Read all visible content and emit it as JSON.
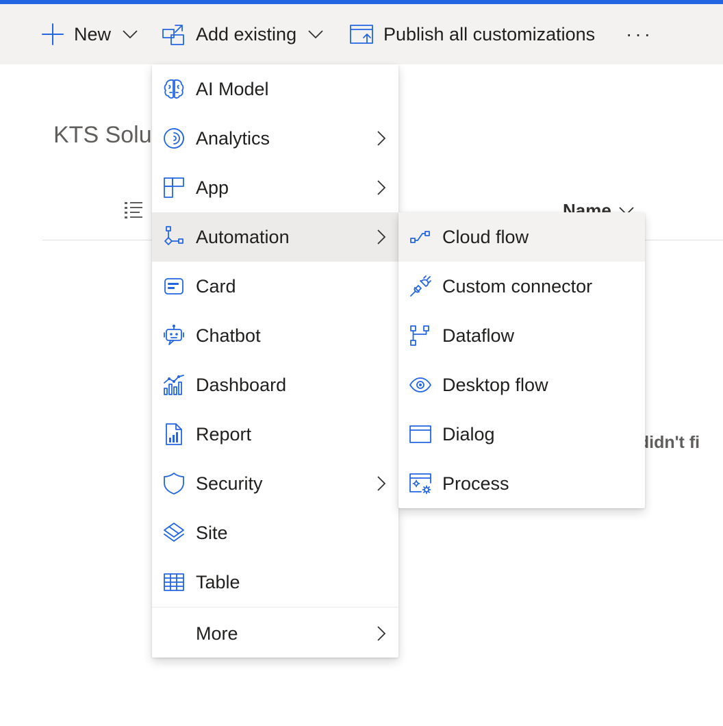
{
  "toolbar": {
    "new_label": "New",
    "add_existing_label": "Add existing",
    "publish_label": "Publish all customizations",
    "more_label": "···"
  },
  "page": {
    "title": "KTS Solut",
    "column_name": "Name",
    "empty_message": "e didn't fi"
  },
  "add_existing_menu": {
    "items": [
      {
        "label": "AI Model",
        "icon": "brain-icon",
        "submenu": false
      },
      {
        "label": "Analytics",
        "icon": "analytics-icon",
        "submenu": true
      },
      {
        "label": "App",
        "icon": "app-grid-icon",
        "submenu": true
      },
      {
        "label": "Automation",
        "icon": "flow-icon",
        "submenu": true,
        "active": true
      },
      {
        "label": "Card",
        "icon": "card-icon",
        "submenu": false
      },
      {
        "label": "Chatbot",
        "icon": "bot-icon",
        "submenu": false
      },
      {
        "label": "Dashboard",
        "icon": "dashboard-icon",
        "submenu": false
      },
      {
        "label": "Report",
        "icon": "report-icon",
        "submenu": false
      },
      {
        "label": "Security",
        "icon": "shield-icon",
        "submenu": true
      },
      {
        "label": "Site",
        "icon": "site-icon",
        "submenu": false
      },
      {
        "label": "Table",
        "icon": "table-icon",
        "submenu": false
      },
      {
        "label": "More",
        "icon": "",
        "submenu": true
      }
    ]
  },
  "automation_submenu": {
    "items": [
      {
        "label": "Cloud flow",
        "icon": "cloud-flow-icon",
        "active": true
      },
      {
        "label": "Custom connector",
        "icon": "plug-icon"
      },
      {
        "label": "Dataflow",
        "icon": "dataflow-icon"
      },
      {
        "label": "Desktop flow",
        "icon": "eye-icon"
      },
      {
        "label": "Dialog",
        "icon": "window-icon"
      },
      {
        "label": "Process",
        "icon": "process-icon"
      }
    ]
  },
  "colors": {
    "accent": "#2266e3",
    "command_bar": "#f3f2f1",
    "menu_hover": "#edebe9"
  }
}
